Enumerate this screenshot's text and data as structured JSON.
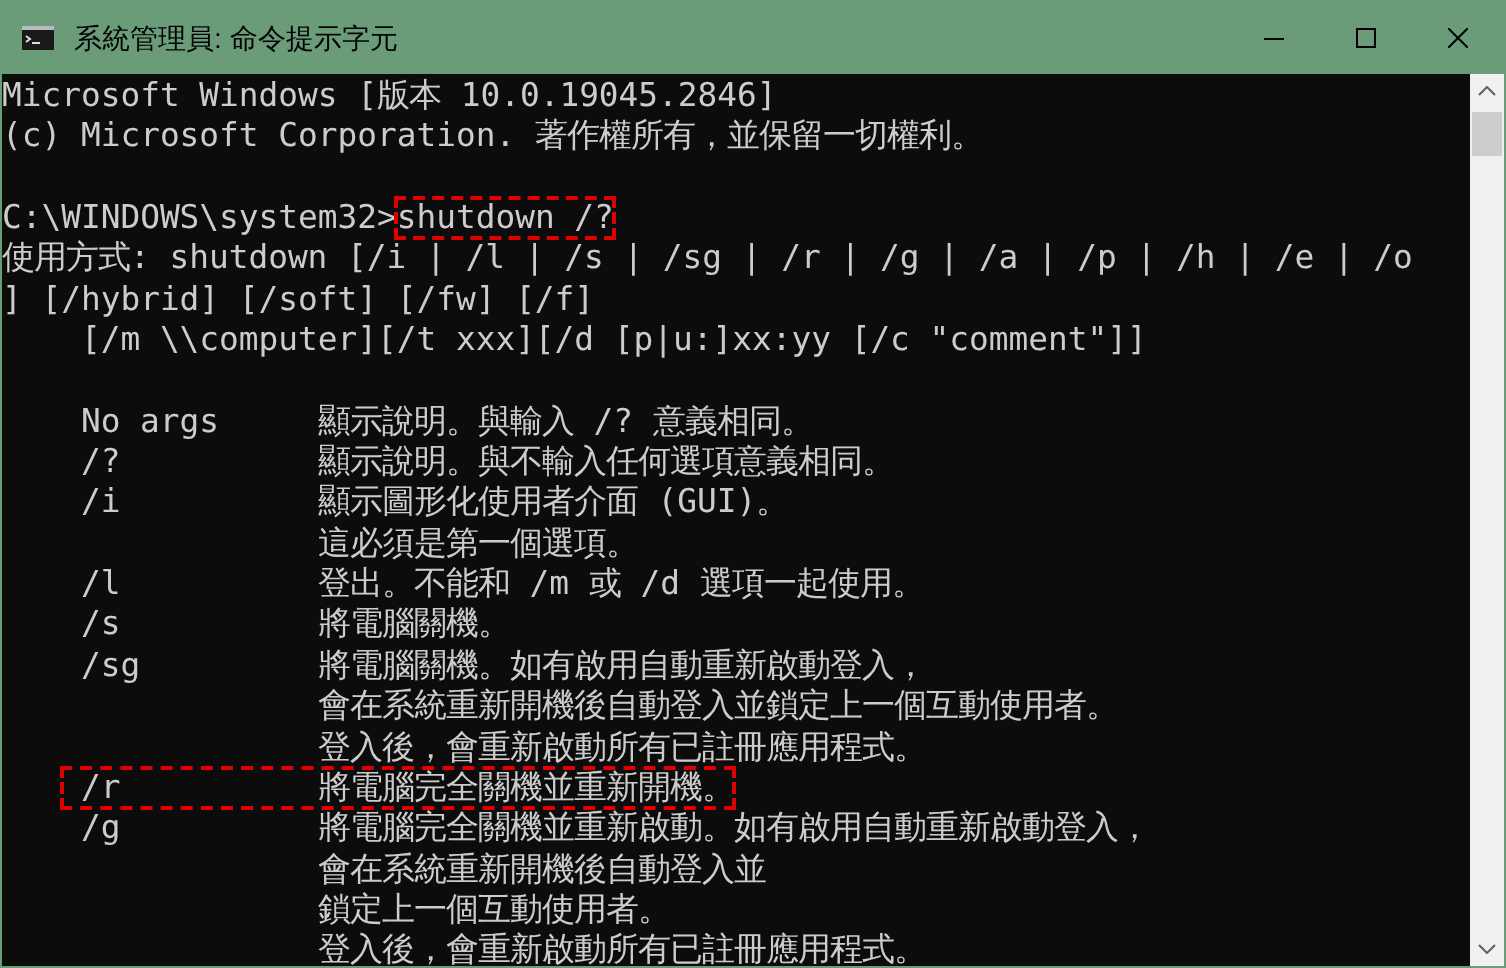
{
  "window": {
    "title": "系統管理員: 命令提示字元"
  },
  "console": {
    "lines": [
      {
        "kind": "text",
        "text": "Microsoft Windows [版本 10.0.19045.2846]"
      },
      {
        "kind": "text",
        "text": "(c) Microsoft Corporation. 著作權所有，並保留一切權利。"
      },
      {
        "kind": "blank"
      },
      {
        "kind": "prompt",
        "path": "C:\\WINDOWS\\system32>",
        "command": "shutdown /?",
        "highlighted": true
      },
      {
        "kind": "text",
        "text": "使用方式: shutdown [/i | /l | /s | /sg | /r | /g | /a | /p | /h | /e | /o"
      },
      {
        "kind": "text",
        "text": "] [/hybrid] [/soft] [/fw] [/f]"
      },
      {
        "kind": "text",
        "text": "    [/m \\\\computer][/t xxx][/d [p|u:]xx:yy [/c \"comment\"]]"
      },
      {
        "kind": "blank"
      },
      {
        "kind": "option",
        "option": "No args",
        "description": "顯示說明。與輸入 /? 意義相同。",
        "highlighted": false
      },
      {
        "kind": "option",
        "option": "/?",
        "description": "顯示說明。與不輸入任何選項意義相同。",
        "highlighted": false
      },
      {
        "kind": "option",
        "option": "/i",
        "description": "顯示圖形化使用者介面 (GUI)。",
        "highlighted": false
      },
      {
        "kind": "continuation",
        "description": "這必須是第一個選項。"
      },
      {
        "kind": "option",
        "option": "/l",
        "description": "登出。不能和 /m 或 /d 選項一起使用。",
        "highlighted": false
      },
      {
        "kind": "option",
        "option": "/s",
        "description": "將電腦關機。",
        "highlighted": false
      },
      {
        "kind": "option",
        "option": "/sg",
        "description": "將電腦關機。如有啟用自動重新啟動登入，",
        "highlighted": false
      },
      {
        "kind": "continuation",
        "description": "會在系統重新開機後自動登入並鎖定上一個互動使用者。"
      },
      {
        "kind": "continuation",
        "description": "登入後，會重新啟動所有已註冊應用程式。"
      },
      {
        "kind": "option",
        "option": "/r",
        "description": "將電腦完全關機並重新開機。",
        "highlighted": true
      },
      {
        "kind": "option",
        "option": "/g",
        "description": "將電腦完全關機並重新啟動。如有啟用自動重新啟動登入，",
        "highlighted": false
      },
      {
        "kind": "continuation",
        "description": "會在系統重新開機後自動登入並"
      },
      {
        "kind": "continuation",
        "description": "鎖定上一個互動使用者。"
      },
      {
        "kind": "continuation",
        "description": "登入後，會重新啟動所有已註冊應用程式。"
      }
    ]
  }
}
